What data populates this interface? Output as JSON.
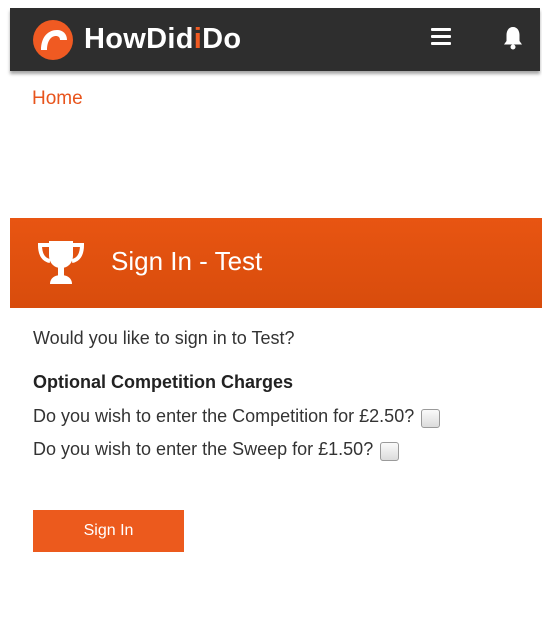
{
  "header": {
    "logo_part1": "HowDid",
    "logo_accent": "i",
    "logo_part2": "Do",
    "menu_icon": "hamburger-menu-icon",
    "notification_icon": "bell-icon"
  },
  "breadcrumb": {
    "home_label": "Home"
  },
  "banner": {
    "icon": "trophy-icon",
    "title": "Sign In - Test"
  },
  "form": {
    "question": "Would you like to sign in to Test?",
    "charges_heading": "Optional Competition Charges",
    "competition_label": "Do you wish to enter the Competition for £2.50?",
    "sweep_label": "Do you wish to enter the Sweep for £1.50?",
    "submit_label": "Sign In"
  },
  "colors": {
    "brand_orange": "#ec5a1d",
    "header_bg": "#2e2e2e",
    "link": "#e8541c"
  }
}
